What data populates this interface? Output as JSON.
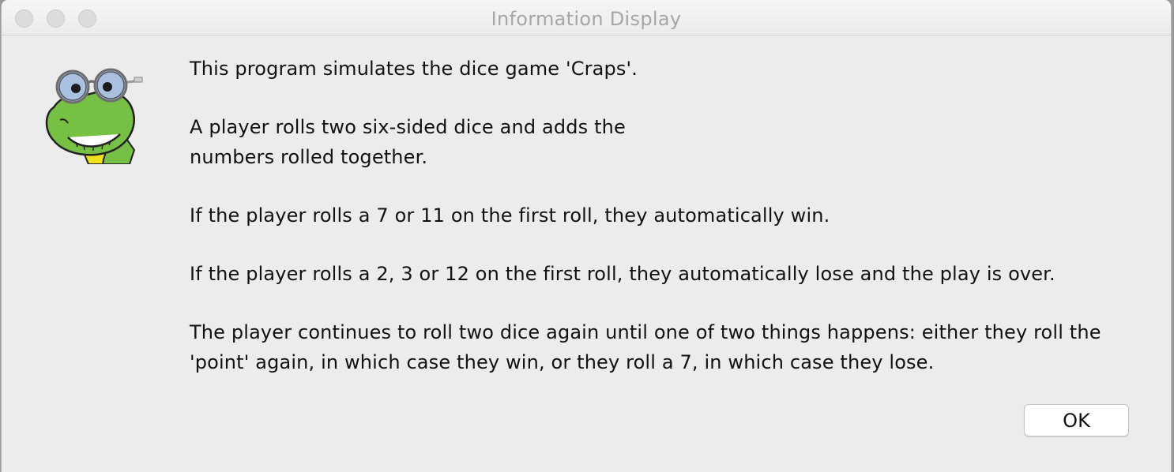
{
  "window": {
    "title": "Information Display"
  },
  "icon": {
    "name": "frog-with-glasses-icon"
  },
  "message": {
    "paragraphs": [
      "This program simulates the dice game 'Craps'.",
      "A player rolls two six-sided dice and adds the\nnumbers rolled together.",
      "If the player rolls a 7 or 11 on the first roll, they automatically win.",
      "If the player rolls a 2, 3 or 12 on the first roll, they automatically lose and the play is over.",
      "The player continues to roll two dice again until one of two things happens: either they roll the\n'point' again, in which case they win, or they roll a 7, in which case they lose."
    ]
  },
  "buttons": {
    "ok_label": "OK"
  },
  "colors": {
    "window_bg": "#ececec",
    "frog_green": "#76c043",
    "glasses_blue": "#9bb3d8"
  }
}
